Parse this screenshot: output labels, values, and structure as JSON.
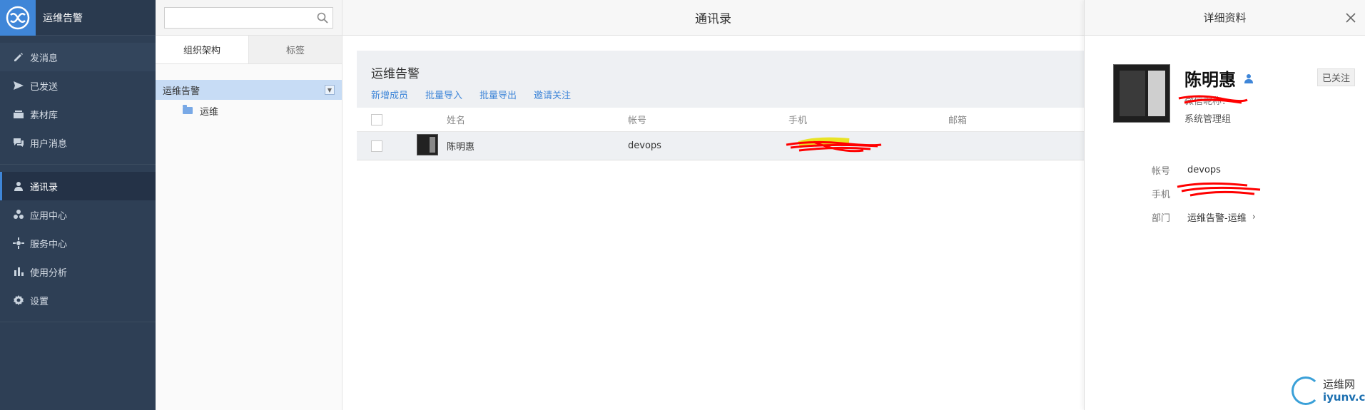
{
  "app": {
    "title": "运维告警"
  },
  "sidebar": {
    "items": [
      {
        "label": "发消息",
        "icon": "pencil-icon"
      },
      {
        "label": "已发送",
        "icon": "send-icon"
      },
      {
        "label": "素材库",
        "icon": "library-icon"
      },
      {
        "label": "用户消息",
        "icon": "chat-icon"
      },
      {
        "label": "通讯录",
        "icon": "contact-icon",
        "active": true
      },
      {
        "label": "应用中心",
        "icon": "apps-icon"
      },
      {
        "label": "服务中心",
        "icon": "service-icon"
      },
      {
        "label": "使用分析",
        "icon": "chart-icon"
      },
      {
        "label": "设置",
        "icon": "gear-icon"
      }
    ]
  },
  "org": {
    "search_placeholder": "",
    "tabs": [
      "组织架构",
      "标签"
    ],
    "root": "运维告警",
    "children": [
      "运维"
    ]
  },
  "header": {
    "title": "通讯录"
  },
  "main": {
    "group_title": "运维告警",
    "actions": [
      "新增成员",
      "批量导入",
      "批量导出",
      "邀请关注"
    ],
    "columns": [
      "姓名",
      "帐号",
      "手机",
      "邮箱"
    ],
    "rows": [
      {
        "name": "陈明惠",
        "account": "devops",
        "phone": "",
        "email": ""
      }
    ]
  },
  "detail": {
    "title": "详细资料",
    "name": "陈明惠",
    "nickname_label": "微信昵称：",
    "role": "系统管理组",
    "follow_status": "已关注",
    "fields": {
      "account_label": "帐号",
      "account_value": "devops",
      "phone_label": "手机",
      "phone_value": "",
      "dept_label": "部门",
      "dept_value": "运维告警-运维"
    }
  },
  "watermark": {
    "cn": "运维网",
    "en": "iyunv.com"
  },
  "colors": {
    "sidebar_bg": "#2e3f55",
    "accent": "#3f86d8",
    "redaction": "#ff0000"
  }
}
